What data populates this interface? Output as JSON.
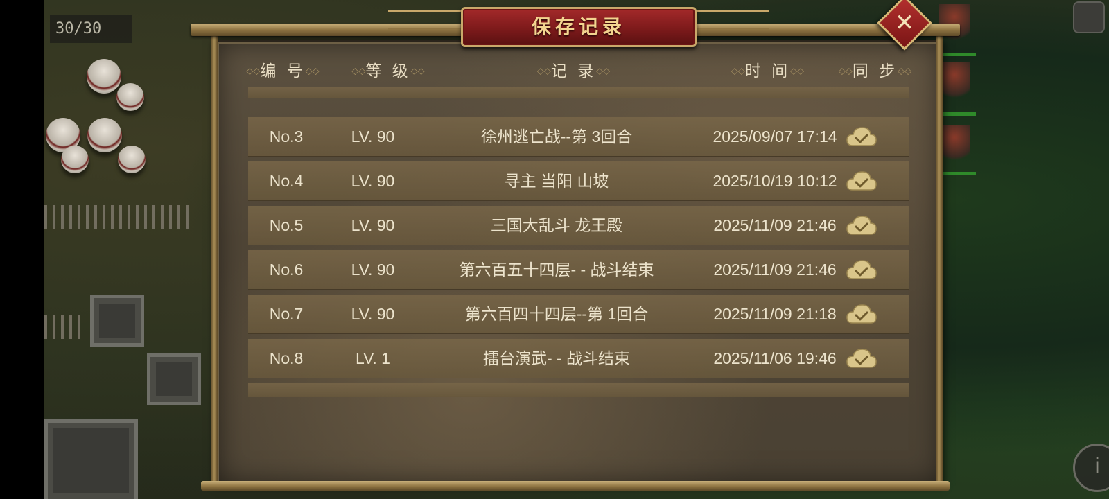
{
  "hud": {
    "counter": "30/30"
  },
  "dialog": {
    "title": "保存记录",
    "close_label": "✕",
    "columns": {
      "number": "编 号",
      "level": "等 级",
      "record": "记 录",
      "time": "时 间",
      "sync": "同 步"
    },
    "rows": [
      {
        "number": "No.3",
        "level": "LV. 90",
        "record": "徐州逃亡战--第 3回合",
        "time": "2025/09/07 17:14",
        "sync_icon": "cloud-check-icon"
      },
      {
        "number": "No.4",
        "level": "LV. 90",
        "record": "寻主 当阳 山坡",
        "time": "2025/10/19 10:12",
        "sync_icon": "cloud-check-icon"
      },
      {
        "number": "No.5",
        "level": "LV. 90",
        "record": "三国大乱斗 龙王殿",
        "time": "2025/11/09 21:46",
        "sync_icon": "cloud-check-icon"
      },
      {
        "number": "No.6",
        "level": "LV. 90",
        "record": "第六百五十四层- - 战斗结束",
        "time": "2025/11/09 21:46",
        "sync_icon": "cloud-check-icon"
      },
      {
        "number": "No.7",
        "level": "LV. 90",
        "record": "第六百四十四层--第 1回合",
        "time": "2025/11/09 21:18",
        "sync_icon": "cloud-check-icon"
      },
      {
        "number": "No.8",
        "level": "LV. 1",
        "record": "擂台演武- - 战斗结束",
        "time": "2025/11/06 19:46",
        "sync_icon": "cloud-check-icon"
      }
    ]
  },
  "colors": {
    "title_plate": "#8a1f1f",
    "title_text": "#f3d48f",
    "row_bg": "#6e5e42",
    "cloud": "#d9c58a"
  }
}
